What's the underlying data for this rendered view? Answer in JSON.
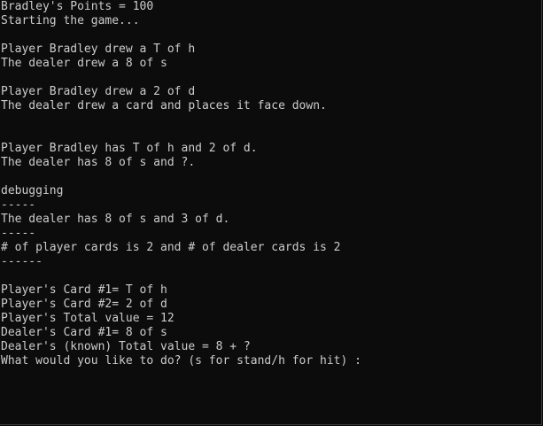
{
  "console": {
    "lines": [
      "Bradley's Points = 100",
      "Starting the game...",
      "",
      "Player Bradley drew a T of h",
      "The dealer drew a 8 of s",
      "",
      "Player Bradley drew a 2 of d",
      "The dealer drew a card and places it face down.",
      "",
      "",
      "Player Bradley has T of h and 2 of d.",
      "The dealer has 8 of s and ?.",
      "",
      "debugging",
      "-----",
      "The dealer has 8 of s and 3 of d.",
      "-----",
      "# of player cards is 2 and # of dealer cards is 2",
      "------",
      "",
      "Player's Card #1= T of h",
      "Player's Card #2= 2 of d",
      "Player's Total value = 12",
      "Dealer's Card #1= 8 of s",
      "Dealer's (known) Total value = 8 + ?",
      "What would you like to do? (s for stand/h for hit) :"
    ]
  }
}
